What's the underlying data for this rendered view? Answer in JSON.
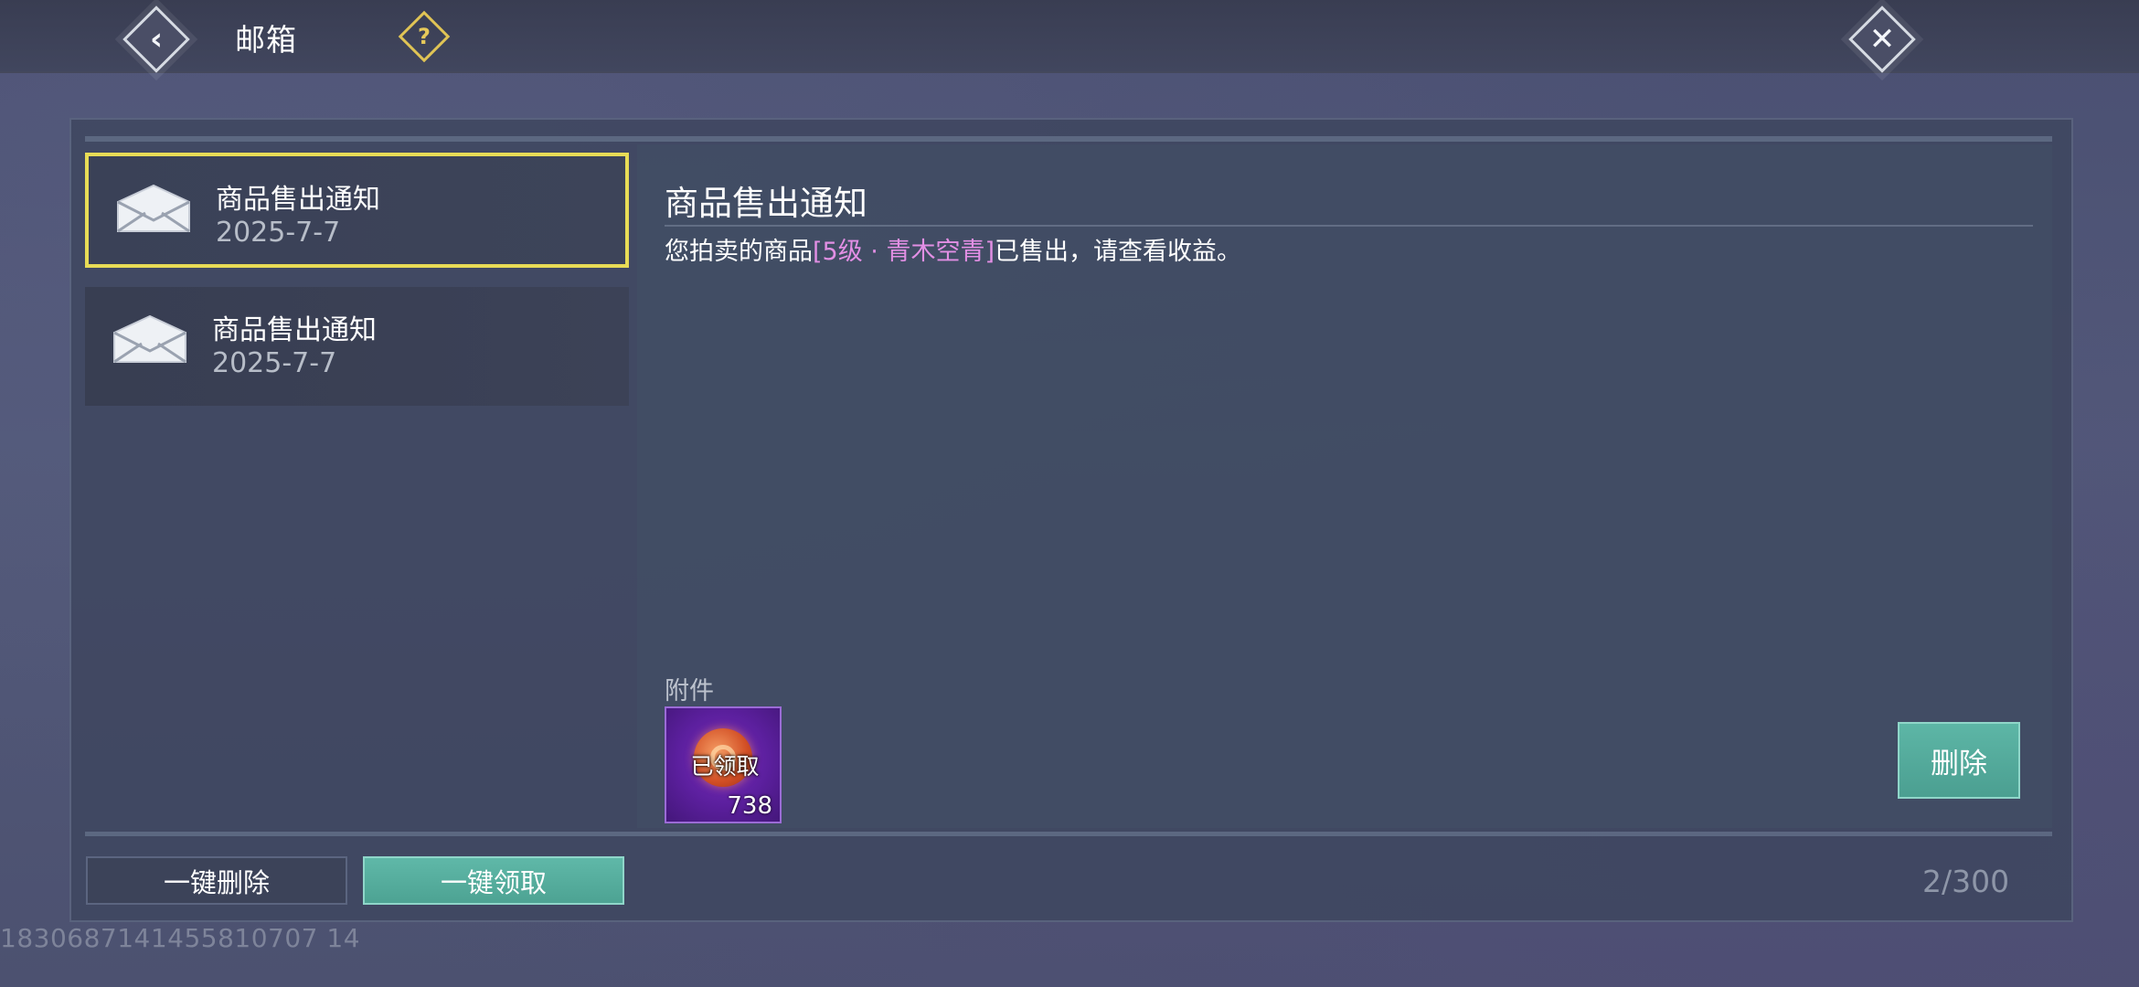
{
  "header": {
    "title": "邮箱",
    "help_icon": "question-icon",
    "back_icon": "back-arrow-icon",
    "close_icon": "close-x-icon"
  },
  "mail_list": [
    {
      "title": "商品售出通知",
      "date": "2025-7-7",
      "selected": true,
      "icon": "envelope-icon"
    },
    {
      "title": "商品售出通知",
      "date": "2025-7-7",
      "selected": false,
      "icon": "envelope-icon"
    }
  ],
  "detail": {
    "title": "商品售出通知",
    "body_prefix": "您拍卖的商品",
    "body_item": "[5级 · 青木空青]",
    "body_suffix": "已售出，请查看收益。",
    "attachment_label": "附件",
    "attachment": {
      "status": "已领取",
      "count": "738",
      "icon": "coin-icon"
    },
    "delete_label": "删除"
  },
  "footer": {
    "bulk_delete_label": "一键删除",
    "bulk_claim_label": "一键领取",
    "mail_count": "2/300"
  },
  "user_id": "1830687141455810707 14",
  "colors": {
    "accent_teal": "#5db6a6",
    "selection_yellow": "#e8dc56",
    "item_highlight": "#e28fe4"
  }
}
